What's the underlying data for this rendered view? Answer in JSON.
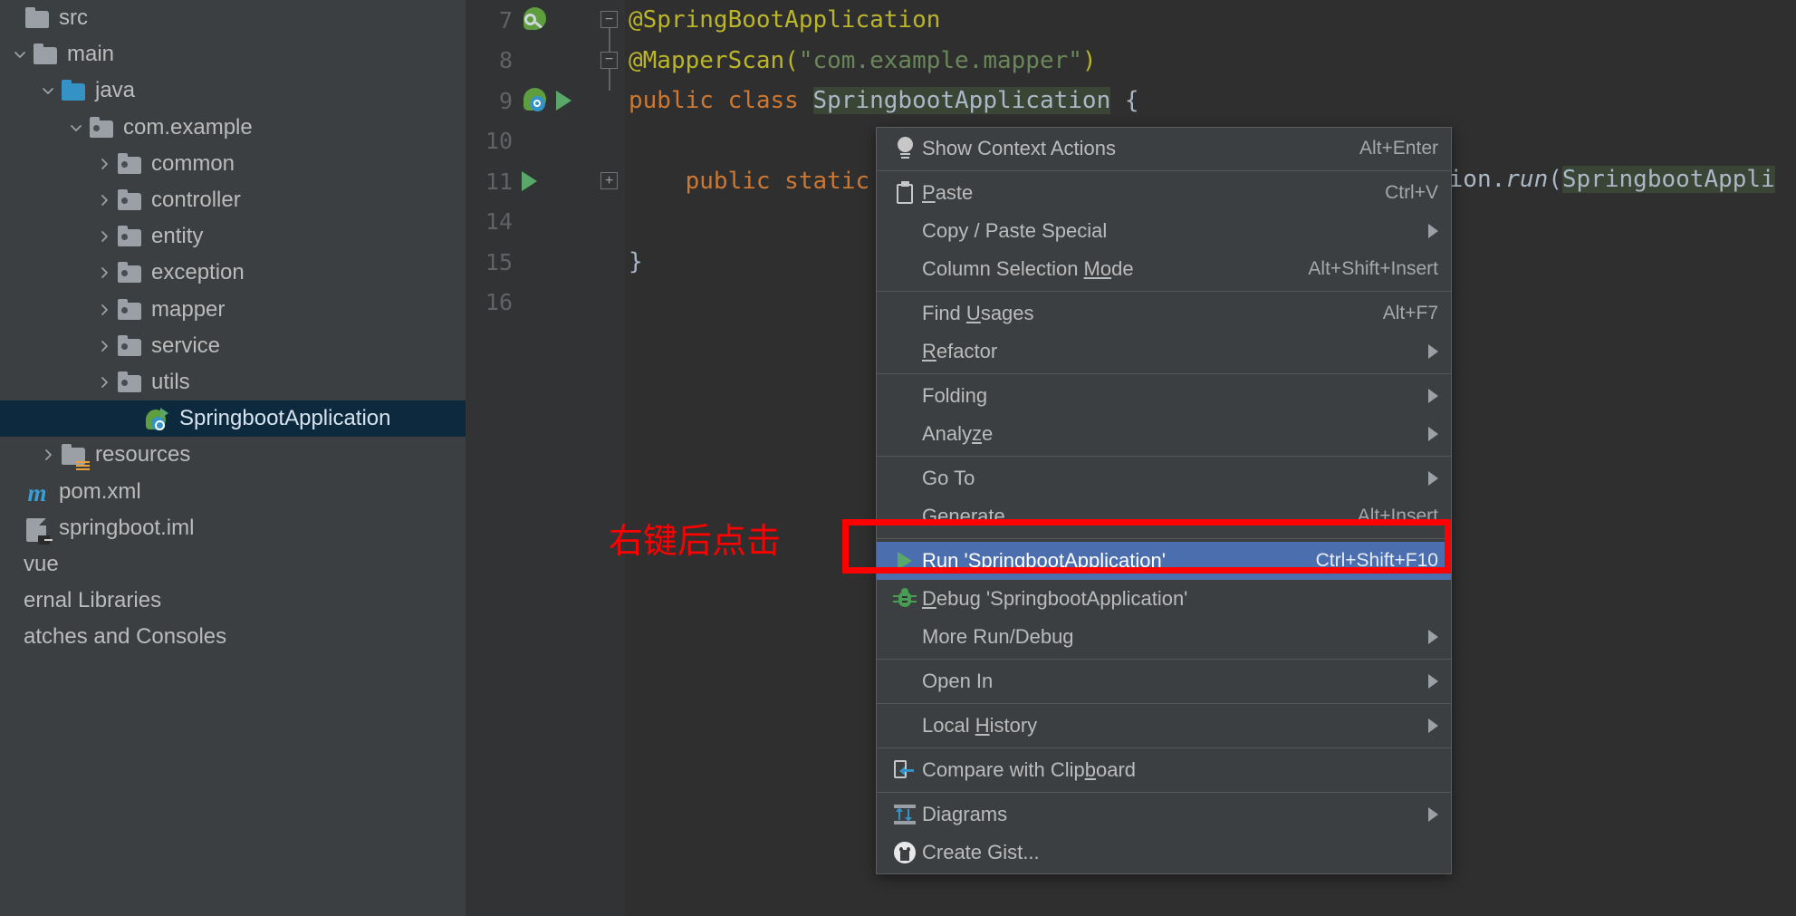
{
  "sidebar": {
    "items": [
      {
        "label": "src",
        "indent": 0,
        "arrow": "none",
        "icon": "folder",
        "selected": false
      },
      {
        "label": "main",
        "indent": 1,
        "arrow": "down",
        "icon": "folder",
        "selected": false
      },
      {
        "label": "java",
        "indent": 2,
        "arrow": "down",
        "icon": "folder-source",
        "selected": false
      },
      {
        "label": "com.example",
        "indent": 3,
        "arrow": "down",
        "icon": "folder-package",
        "selected": false
      },
      {
        "label": "common",
        "indent": 4,
        "arrow": "right",
        "icon": "folder-package",
        "selected": false
      },
      {
        "label": "controller",
        "indent": 4,
        "arrow": "right",
        "icon": "folder-package",
        "selected": false
      },
      {
        "label": "entity",
        "indent": 4,
        "arrow": "right",
        "icon": "folder-package",
        "selected": false
      },
      {
        "label": "exception",
        "indent": 4,
        "arrow": "right",
        "icon": "folder-package",
        "selected": false
      },
      {
        "label": "mapper",
        "indent": 4,
        "arrow": "right",
        "icon": "folder-package",
        "selected": false
      },
      {
        "label": "service",
        "indent": 4,
        "arrow": "right",
        "icon": "folder-package",
        "selected": false
      },
      {
        "label": "utils",
        "indent": 4,
        "arrow": "right",
        "icon": "folder-package",
        "selected": false
      },
      {
        "label": "SpringbootApplication",
        "indent": 5,
        "arrow": "none",
        "icon": "springboot-class",
        "selected": true
      },
      {
        "label": "resources",
        "indent": 2,
        "arrow": "right",
        "icon": "folder-resources",
        "selected": false
      },
      {
        "label": "pom.xml",
        "indent": 0,
        "arrow": "none",
        "icon": "maven",
        "selected": false
      },
      {
        "label": "springboot.iml",
        "indent": 0,
        "arrow": "none",
        "icon": "iml",
        "selected": false
      },
      {
        "label": "vue",
        "indent": -1,
        "arrow": "none",
        "icon": "none",
        "selected": false
      },
      {
        "label": "ernal Libraries",
        "indent": -1,
        "arrow": "none",
        "icon": "none",
        "selected": false
      },
      {
        "label": "atches and Consoles",
        "indent": -1,
        "arrow": "none",
        "icon": "none",
        "selected": false
      }
    ]
  },
  "editor": {
    "lines": [
      {
        "num": "7",
        "gutter_icons": [
          "spring-bean-icon"
        ],
        "fold": "minus-top",
        "segments": [
          {
            "t": "@SpringBootApplication",
            "c": "k-ann"
          }
        ]
      },
      {
        "num": "8",
        "gutter_icons": [],
        "fold": "minus",
        "segments": [
          {
            "t": "@MapperScan(",
            "c": "k-ann"
          },
          {
            "t": "\"com.example.mapper\"",
            "c": "k-str"
          },
          {
            "t": ")",
            "c": "k-ann"
          }
        ]
      },
      {
        "num": "9",
        "gutter_icons": [
          "spring-boot-run-icon",
          "run-icon"
        ],
        "fold": "none",
        "segments": [
          {
            "t": "public class ",
            "c": "k-kw"
          },
          {
            "t": "SpringbootApplication",
            "c": "hl-ident"
          },
          {
            "t": " {",
            "c": "k-cls"
          }
        ]
      },
      {
        "num": "10",
        "gutter_icons": [],
        "fold": "none",
        "segments": []
      },
      {
        "num": "11",
        "gutter_icons": [
          "run-icon"
        ],
        "fold": "plus",
        "segments": [
          {
            "t": "    public static v",
            "c": "k-kw"
          }
        ]
      },
      {
        "num": "14",
        "gutter_icons": [],
        "fold": "none",
        "segments": []
      },
      {
        "num": "15",
        "gutter_icons": [],
        "fold": "none",
        "segments": [
          {
            "t": "}",
            "c": "k-cls"
          }
        ]
      },
      {
        "num": "16",
        "gutter_icons": [],
        "fold": "none",
        "segments": []
      }
    ],
    "right_fragment": "tion.run(SpringbootAppli",
    "right_fragment_head": "tion.",
    "right_fragment_method": "run",
    "right_fragment_paren": "(",
    "right_fragment_ident": "SpringbootAppli"
  },
  "context_menu": {
    "items": [
      {
        "label": "Show Context Actions",
        "mnemonic": "",
        "shortcut": "Alt+Enter",
        "icon": "lightbulb-icon",
        "submenu": false,
        "selected": false,
        "sep_after": true
      },
      {
        "label": "Paste",
        "mnemonic": "P",
        "shortcut": "Ctrl+V",
        "icon": "clipboard-icon",
        "submenu": false,
        "selected": false,
        "sep_after": false
      },
      {
        "label": "Copy / Paste Special",
        "mnemonic": "",
        "shortcut": "",
        "icon": "",
        "submenu": true,
        "selected": false,
        "sep_after": false
      },
      {
        "label": "Column Selection Mode",
        "mnemonic": "Mo",
        "shortcut": "Alt+Shift+Insert",
        "icon": "",
        "submenu": false,
        "selected": false,
        "sep_after": true
      },
      {
        "label": "Find Usages",
        "mnemonic": "U",
        "shortcut": "Alt+F7",
        "icon": "",
        "submenu": false,
        "selected": false,
        "sep_after": false
      },
      {
        "label": "Refactor",
        "mnemonic": "R",
        "shortcut": "",
        "icon": "",
        "submenu": true,
        "selected": false,
        "sep_after": true
      },
      {
        "label": "Folding",
        "mnemonic": "",
        "shortcut": "",
        "icon": "",
        "submenu": true,
        "selected": false,
        "sep_after": false
      },
      {
        "label": "Analyze",
        "mnemonic": "z",
        "shortcut": "",
        "icon": "",
        "submenu": true,
        "selected": false,
        "sep_after": true
      },
      {
        "label": "Go To",
        "mnemonic": "",
        "shortcut": "",
        "icon": "",
        "submenu": true,
        "selected": false,
        "sep_after": false
      },
      {
        "label": "Generate",
        "mnemonic": "",
        "shortcut": "Alt+Insert",
        "icon": "",
        "submenu": false,
        "selected": false,
        "sep_after": true
      },
      {
        "label": "Run 'SpringbootApplication'",
        "mnemonic": "u",
        "shortcut": "Ctrl+Shift+F10",
        "icon": "run-icon",
        "submenu": false,
        "selected": true,
        "sep_after": false
      },
      {
        "label": "Debug 'SpringbootApplication'",
        "mnemonic": "D",
        "shortcut": "",
        "icon": "debug-bug-icon",
        "submenu": false,
        "selected": false,
        "sep_after": false
      },
      {
        "label": "More Run/Debug",
        "mnemonic": "",
        "shortcut": "",
        "icon": "",
        "submenu": true,
        "selected": false,
        "sep_after": true
      },
      {
        "label": "Open In",
        "mnemonic": "",
        "shortcut": "",
        "icon": "",
        "submenu": true,
        "selected": false,
        "sep_after": true
      },
      {
        "label": "Local History",
        "mnemonic": "H",
        "shortcut": "",
        "icon": "",
        "submenu": true,
        "selected": false,
        "sep_after": true
      },
      {
        "label": "Compare with Clipboard",
        "mnemonic": "b",
        "shortcut": "",
        "icon": "compare-icon",
        "submenu": false,
        "selected": false,
        "sep_after": true
      },
      {
        "label": "Diagrams",
        "mnemonic": "",
        "shortcut": "",
        "icon": "diagrams-icon",
        "submenu": true,
        "selected": false,
        "sep_after": false
      },
      {
        "label": "Create Gist...",
        "mnemonic": "",
        "shortcut": "",
        "icon": "github-icon",
        "submenu": false,
        "selected": false,
        "sep_after": false
      }
    ]
  },
  "annotations": {
    "note_text": "右键后点击",
    "note_color": "#fe0000",
    "highlight_color": "#fe0000"
  },
  "colors": {
    "sidebar_bg": "#3c3f41",
    "editor_bg": "#2f2f2f",
    "gutter_bg": "#313335",
    "menu_bg": "#3c3f41",
    "menu_selected_bg": "#4b6eaf",
    "tree_selected_bg": "#0d293e",
    "annotation_color": "#bbb529",
    "keyword_color": "#cc7832",
    "string_color": "#6a8759",
    "text_color": "#a9b7c6",
    "run_green": "#59a869"
  }
}
